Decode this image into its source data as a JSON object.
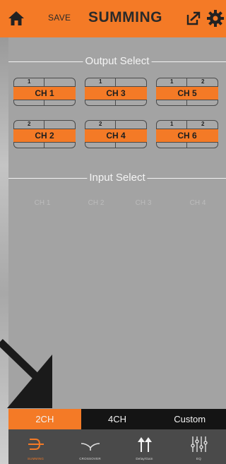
{
  "header": {
    "save_label": "SAVE",
    "title": "SUMMING",
    "accent_color": "#f47a26"
  },
  "output_select": {
    "label": "Output Select",
    "channels": [
      {
        "label": "CH 1",
        "top_left": "1",
        "top_right": ""
      },
      {
        "label": "CH 3",
        "top_left": "1",
        "top_right": ""
      },
      {
        "label": "CH 5",
        "top_left": "1",
        "top_right": "2"
      },
      {
        "label": "CH 2",
        "top_left": "2",
        "top_right": ""
      },
      {
        "label": "CH 4",
        "top_left": "2",
        "top_right": ""
      },
      {
        "label": "CH 6",
        "top_left": "1",
        "top_right": "2"
      }
    ]
  },
  "input_select": {
    "label": "Input Select",
    "channels": [
      "CH 1",
      "CH 2",
      "CH 3",
      "CH 4"
    ]
  },
  "mode_tabs": [
    {
      "label": "2CH",
      "active": true
    },
    {
      "label": "4CH",
      "active": false
    },
    {
      "label": "Custom",
      "active": false
    }
  ],
  "bottom_nav": [
    {
      "label": "SUMMING",
      "icon": "summing-icon",
      "active": true
    },
    {
      "label": "CROSSOVER",
      "icon": "crossover-icon",
      "active": false
    },
    {
      "label": "Delay/Gain",
      "icon": "delay-gain-icon",
      "active": false
    },
    {
      "label": "EQ",
      "icon": "eq-icon",
      "active": false
    }
  ]
}
